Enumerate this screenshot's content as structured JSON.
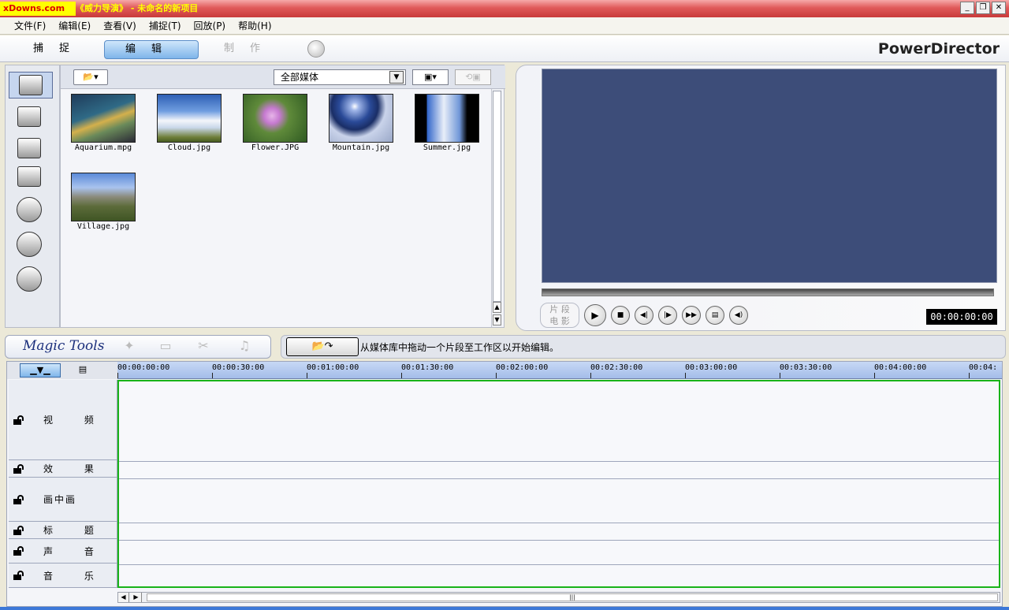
{
  "window": {
    "badge": "xDowns.com",
    "title": "《威力导演》 - 未命名的新项目",
    "controls": {
      "minimize": "_",
      "restore": "❐",
      "close": "✕"
    }
  },
  "menu": [
    "文件(F)",
    "编辑(E)",
    "查看(V)",
    "捕捉(T)",
    "回放(P)",
    "帮助(H)"
  ],
  "modes": {
    "capture": "捕捉",
    "edit": "编辑",
    "produce": "制作"
  },
  "brand": "PowerDirector",
  "library": {
    "filter": "全部媒体",
    "items": [
      {
        "name": "Aquarium.mpg",
        "icon": "aquarium-thumbnail"
      },
      {
        "name": "Cloud.jpg",
        "icon": "cloud-thumbnail"
      },
      {
        "name": "Flower.JPG",
        "icon": "flower-thumbnail"
      },
      {
        "name": "Mountain.jpg",
        "icon": "mountain-thumbnail"
      },
      {
        "name": "Summer.jpg",
        "icon": "summer-thumbnail"
      },
      {
        "name": "Village.jpg",
        "icon": "village-thumbnail"
      }
    ]
  },
  "preview": {
    "mode_clip": "片 段",
    "mode_movie": "电 影",
    "timecode": "00:00:00:00"
  },
  "magic_tools": {
    "title": "Magic Tools"
  },
  "hint": {
    "text": "从媒体库中拖动一个片段至工作区以开始编辑。"
  },
  "timeline": {
    "ruler": [
      "00:00:00:00",
      "00:00:30:00",
      "00:01:00:00",
      "00:01:30:00",
      "00:02:00:00",
      "00:02:30:00",
      "00:03:00:00",
      "00:03:30:00",
      "00:04:00:00",
      "00:04:"
    ],
    "tracks": [
      "视 频",
      "效 果",
      "画中画",
      "标 题",
      "声 音",
      "音 乐"
    ]
  }
}
